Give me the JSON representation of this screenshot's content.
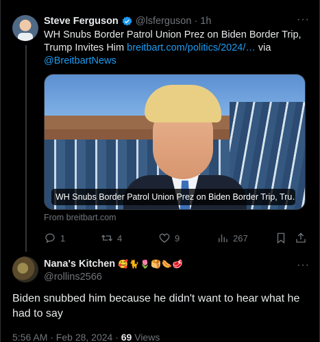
{
  "tweet": {
    "author_name": "Steve Ferguson",
    "handle": "@lsferguson",
    "separator": "·",
    "time": "1h",
    "more": "···",
    "text_main": "WH Snubs Border Patrol Union Prez on Biden Border Trip, Trump Invites Him ",
    "link": "breitbart.com/politics/2024/…",
    "text_via": " via ",
    "mention": "@BreitbartNews",
    "card_caption": "WH Snubs Border Patrol Union Prez on Biden Border Trip, Tru…",
    "card_source": "From breitbart.com",
    "actions": {
      "replies": "1",
      "reposts": "4",
      "likes": "9",
      "views": "267"
    },
    "colors": {
      "accent": "#1d9bf0",
      "muted": "#71767b",
      "bg": "#000000"
    }
  },
  "reply": {
    "author_name": "Nana's Kitchen",
    "emojis": "🥰🐈🌷🥞🌭🥩",
    "handle": "@rollins2566",
    "more": "···",
    "text": "Biden snubbed him because he didn't want to hear what he had to say",
    "time": "5:56 AM · Feb 28, 2024 · ",
    "views_count": "69",
    "views_label": " Views"
  }
}
